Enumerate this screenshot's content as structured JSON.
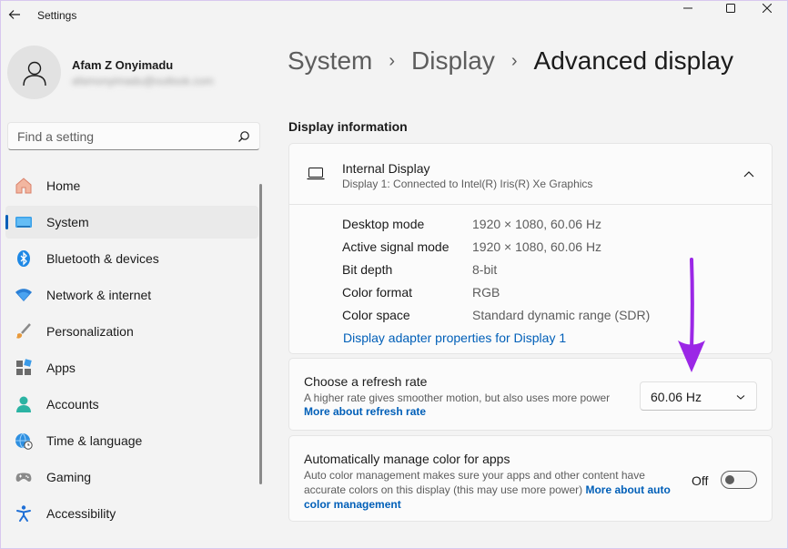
{
  "window": {
    "title": "Settings"
  },
  "profile": {
    "name": "Afam Z Onyimadu",
    "email": "afamonyimadu@outlook.com"
  },
  "search": {
    "placeholder": "Find a setting"
  },
  "nav": {
    "items": [
      {
        "label": "Home",
        "icon": "home-icon"
      },
      {
        "label": "System",
        "icon": "system-icon",
        "active": true
      },
      {
        "label": "Bluetooth & devices",
        "icon": "bluetooth-icon"
      },
      {
        "label": "Network & internet",
        "icon": "wifi-icon"
      },
      {
        "label": "Personalization",
        "icon": "brush-icon"
      },
      {
        "label": "Apps",
        "icon": "apps-icon"
      },
      {
        "label": "Accounts",
        "icon": "accounts-icon"
      },
      {
        "label": "Time & language",
        "icon": "globe-clock-icon"
      },
      {
        "label": "Gaming",
        "icon": "gamepad-icon"
      },
      {
        "label": "Accessibility",
        "icon": "accessibility-icon"
      }
    ]
  },
  "breadcrumb": {
    "items": [
      "System",
      "Display"
    ],
    "current": "Advanced display",
    "separator": "›"
  },
  "display_info": {
    "section_title": "Display information",
    "display_name": "Internal Display",
    "display_subtitle": "Display 1: Connected to Intel(R) Iris(R) Xe Graphics",
    "rows": [
      {
        "key": "Desktop mode",
        "value": "1920 × 1080, 60.06 Hz"
      },
      {
        "key": "Active signal mode",
        "value": "1920 × 1080, 60.06 Hz"
      },
      {
        "key": "Bit depth",
        "value": "8-bit"
      },
      {
        "key": "Color format",
        "value": "RGB"
      },
      {
        "key": "Color space",
        "value": "Standard dynamic range (SDR)"
      }
    ],
    "adapter_link": "Display adapter properties for Display 1"
  },
  "refresh_rate": {
    "title": "Choose a refresh rate",
    "description": "A higher rate gives smoother motion, but also uses more power",
    "link": "More about refresh rate",
    "selected": "60.06 Hz"
  },
  "color_management": {
    "title": "Automatically manage color for apps",
    "description": "Auto color management makes sure your apps and other content have accurate colors on this display (this may use more power)",
    "link": "More about auto color management",
    "toggle_label": "Off",
    "toggle_state": false
  },
  "colors": {
    "accent": "#005fb8",
    "annotation_arrow": "#9b27e6"
  }
}
